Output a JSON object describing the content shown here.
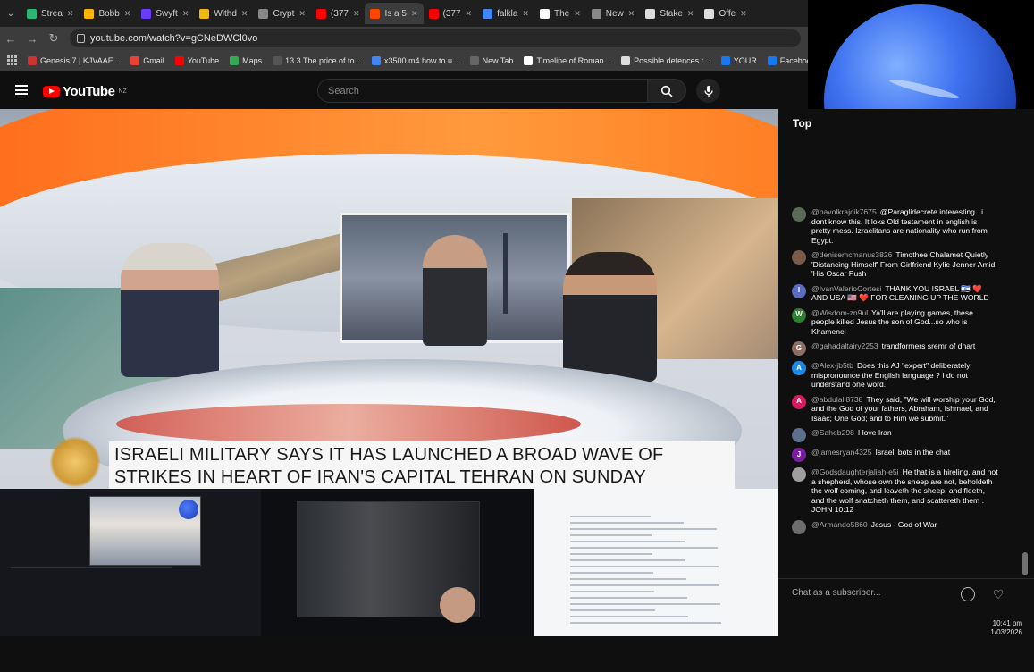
{
  "browser": {
    "tabs": [
      {
        "label": "Strea",
        "color": "#2bb673"
      },
      {
        "label": "Bobb",
        "color": "#ffb400"
      },
      {
        "label": "Swyft",
        "color": "#6c3bff"
      },
      {
        "label": "Withd",
        "color": "#f0b90b"
      },
      {
        "label": "Crypt",
        "color": "#888888"
      },
      {
        "label": "(377",
        "color": "#ff0000",
        "active": false
      },
      {
        "label": "Is a 5",
        "color": "#ff4500",
        "active": true
      },
      {
        "label": "(377",
        "color": "#ff0000"
      },
      {
        "label": "falkla",
        "color": "#4285f4"
      },
      {
        "label": "The",
        "color": "#ffffff"
      },
      {
        "label": "New",
        "color": "#888888"
      },
      {
        "label": "Stake",
        "color": "#dddddd"
      },
      {
        "label": "Offe",
        "color": "#dddddd"
      }
    ],
    "url": "youtube.com/watch?v=gCNeDWCl0vo",
    "bookmarks": [
      {
        "label": "Genesis 7 | KJVAAE...",
        "color": "#cc3333"
      },
      {
        "label": "Gmail",
        "color": "#ea4335"
      },
      {
        "label": "YouTube",
        "color": "#ff0000"
      },
      {
        "label": "Maps",
        "color": "#34a853"
      },
      {
        "label": "13.3 The price of to...",
        "color": "#555555"
      },
      {
        "label": "x3500 m4 how to u...",
        "color": "#4285f4"
      },
      {
        "label": "New Tab",
        "color": "#666666"
      },
      {
        "label": "Timeline of Roman...",
        "color": "#ffffff"
      },
      {
        "label": "Possible defences t...",
        "color": "#dddddd"
      },
      {
        "label": "YOUR",
        "color": "#1877f2"
      },
      {
        "label": "Facebook green",
        "color": "#1877f2"
      }
    ]
  },
  "youtube": {
    "logo_text": "YouTube",
    "region": "NZ",
    "search_placeholder": "Search"
  },
  "video": {
    "headline_line1": "ISRAELI MILITARY SAYS IT HAS LAUNCHED A BROAD WAVE OF",
    "headline_line2": "STRIKES IN HEART OF IRAN'S CAPITAL TEHRAN ON SUNDAY"
  },
  "chat": {
    "header_label": "Top",
    "input_placeholder": "Chat as a subscriber...",
    "messages": [
      {
        "author": "@pavolkrajcik7675",
        "text": "@Paraglidecrete interesting.. i dont know this. It loks Old testament in english is pretty mess. Izraelitans are nationality who run from Egypt.",
        "avatar": "",
        "avatar_color": "#5a6b55"
      },
      {
        "author": "@denisemcmanus3826",
        "text": "Timothee Chalamet Quietly 'Distancing Himself' From Girlfriend Kylie Jenner Amid 'His Oscar Push",
        "avatar": "",
        "avatar_color": "#7a5a48"
      },
      {
        "author": "@IvanValerioCortesi",
        "text": "THANK YOU ISRAEL 🇮🇱 ❤️ AND USA 🇺🇸 ❤️ FOR CLEANING UP THE WORLD",
        "avatar": "I",
        "avatar_color": "#5c6bc0"
      },
      {
        "author": "@Wisdom-zn9ul",
        "text": "Ya'll are playing games, these people killed Jesus the son of God...so who is Khamenei",
        "avatar": "W",
        "avatar_color": "#2e7d32"
      },
      {
        "author": "@gahadaltairy2253",
        "text": "trandformers sremr of dnart",
        "avatar": "G",
        "avatar_color": "#8d6e63"
      },
      {
        "author": "@Alex-jb5tb",
        "text": "Does this AJ \"expert\" deliberately mispronounce the English language ? I do not understand one word.",
        "avatar": "A",
        "avatar_color": "#1e88e5"
      },
      {
        "author": "@abdulali8738",
        "text": "They said, \"We will worship your God, and the God of your fathers, Abraham, Ishmael, and Isaac; One God; and to Him we submit.\"",
        "avatar": "A",
        "avatar_color": "#d81b60"
      },
      {
        "author": "@Saheb298",
        "text": "I love Iran",
        "avatar": "",
        "avatar_color": "#5d6f8a"
      },
      {
        "author": "@jamesryan4325",
        "text": "Israeli bots in the chat",
        "avatar": "J",
        "avatar_color": "#7b1fa2"
      },
      {
        "author": "@Godsdaughterjaliah-e5i",
        "text": "He that is a hireling, and not a shepherd, whose own the sheep are not, beholdeth the wolf coming, and leaveth the sheep, and fleeth, and the wolf snatcheth them, and scattereth them . JOHN 10:12",
        "avatar": "",
        "avatar_color": "#9e9e9e"
      },
      {
        "author": "@Armando5860",
        "text": "Jesus - God of War",
        "avatar": "",
        "avatar_color": "#6d6d6d"
      }
    ]
  },
  "system": {
    "time": "10:41 pm",
    "date": "1/03/2026"
  }
}
